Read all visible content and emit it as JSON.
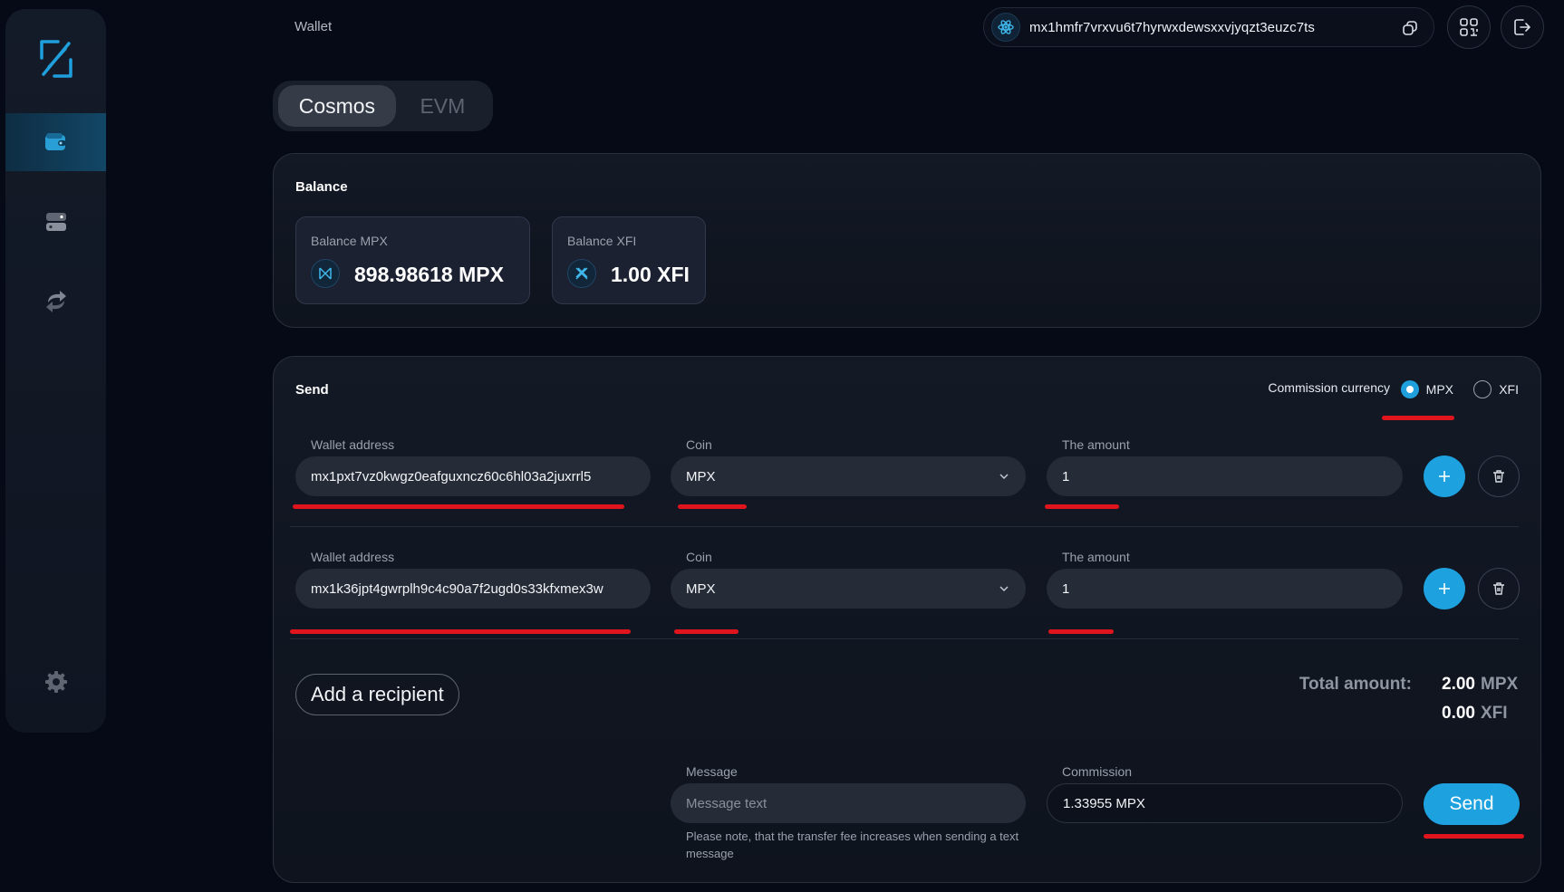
{
  "header": {
    "title": "Wallet",
    "address": "mx1hmfr7vrxvu6t7hyrwxdewsxxvjyqzt3euzc7ts"
  },
  "tabs": [
    {
      "label": "Cosmos",
      "active": true
    },
    {
      "label": "EVM",
      "active": false
    }
  ],
  "balance": {
    "title": "Balance",
    "items": [
      {
        "label": "Balance MPX",
        "value": "898.98618 MPX"
      },
      {
        "label": "Balance XFI",
        "value": "1.00 XFI"
      }
    ]
  },
  "send": {
    "title": "Send",
    "commission_currency_label": "Commission currency",
    "currency_options": [
      {
        "label": "MPX",
        "selected": true
      },
      {
        "label": "XFI",
        "selected": false
      }
    ],
    "labels": {
      "wallet_address": "Wallet address",
      "coin": "Coin",
      "amount": "The amount"
    },
    "recipients": [
      {
        "address": "mx1pxt7vz0kwgz0eafguxncz60c6hl03a2juxrrl5",
        "coin": "MPX",
        "amount": "1"
      },
      {
        "address": "mx1k36jpt4gwrplh9c4c90a7f2ugd0s33kfxmex3w",
        "coin": "MPX",
        "amount": "1"
      }
    ],
    "add_recipient_label": "Add a recipient",
    "total_label": "Total amount:",
    "totals": [
      {
        "value": "2.00",
        "currency": "MPX"
      },
      {
        "value": "0.00",
        "currency": "XFI"
      }
    ],
    "message_label": "Message",
    "message_placeholder": "Message text",
    "note": "Please note, that the transfer fee increases when sending a text message",
    "commission_label": "Commission",
    "commission_value": "1.33955 MPX",
    "send_label": "Send"
  },
  "colors": {
    "accent": "#1ea1df",
    "background": "#060a16",
    "annotation": "#e0141c"
  }
}
